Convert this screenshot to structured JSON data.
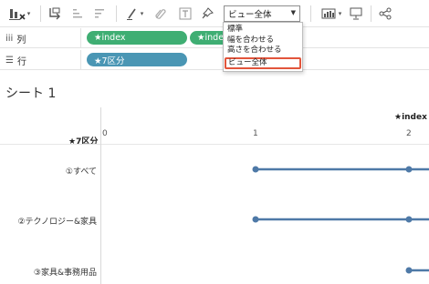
{
  "toolbar": {
    "icons": [
      "chart-swap-icon",
      "sort-asc-icon",
      "sort-desc-icon",
      "highlight-pen-icon",
      "clip-icon",
      "text-label-icon",
      "pin-icon",
      "show-me-icon",
      "presentation-icon",
      "share-icon"
    ],
    "fit_value": "ビュー全体"
  },
  "fit_menu": {
    "options": [
      "標準",
      "幅を合わせる",
      "高さを合わせる",
      "ビュー全体"
    ],
    "selected_index": 3
  },
  "columns_shelf": {
    "label": "列",
    "pills": [
      "★index",
      "★inde"
    ]
  },
  "rows_shelf": {
    "label": "行",
    "pills": [
      "★7区分"
    ]
  },
  "sheet": {
    "title": "シート 1",
    "row_header": "★7区分",
    "axis_title": "★index",
    "ticks": [
      "0",
      "1",
      "2"
    ],
    "rows": [
      "①すべて",
      "②テクノロジー&家具",
      "③家具&事務用品"
    ]
  },
  "chart_data": {
    "type": "line",
    "x_axis_label": "★index",
    "categories": [
      "①すべて",
      "②テクノロジー&家具",
      "③家具&事務用品"
    ],
    "segments": [
      {
        "category": "①すべて",
        "x": [
          1,
          2
        ]
      },
      {
        "category": "②テクノロジー&家具",
        "x": [
          1,
          2
        ]
      },
      {
        "category": "③家具&事務用品",
        "x": [
          2
        ]
      }
    ],
    "xlim": [
      0,
      2
    ],
    "colors": {
      "line": "#4e79a7"
    }
  }
}
